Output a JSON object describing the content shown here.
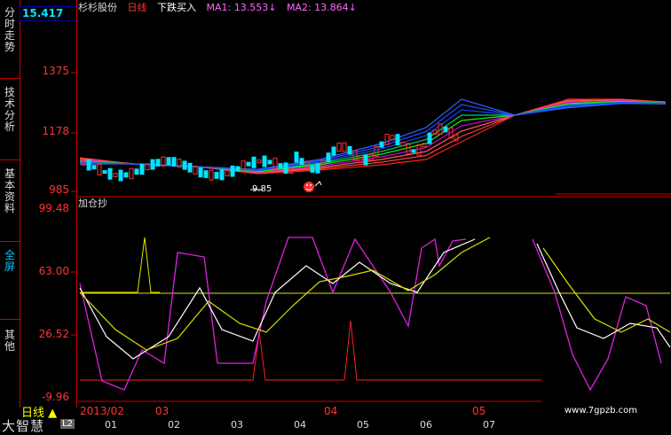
{
  "window": {
    "price_box": "15.417",
    "stock_name": "杉杉股份",
    "period": "日线",
    "signal": "下跌买入",
    "ma1_label": "MA1: 13.553↓",
    "ma2_label": "MA2: 13.864↓"
  },
  "sidebar": {
    "tabs": [
      {
        "label": "分时走势",
        "active": false
      },
      {
        "label": "技术分析",
        "active": false
      },
      {
        "label": "基本资料",
        "active": false
      },
      {
        "label": "全屏",
        "active": true
      },
      {
        "label": "其他",
        "active": false
      }
    ]
  },
  "price_axis": {
    "labels": [
      "1375",
      "1178",
      "985"
    ]
  },
  "kline_annotation": "9.85",
  "indicator": {
    "title": "加仓抄",
    "axis_labels": [
      "99.48",
      "63.00",
      "26.52",
      "-9.96"
    ]
  },
  "bottom_bar": {
    "period_label": "日线",
    "brand": "大智慧",
    "brand_badge": "L2",
    "months": [
      "2013/02",
      "03",
      "04",
      "05"
    ],
    "subticks": [
      "01",
      "02",
      "03",
      "04",
      "05",
      "06",
      "07"
    ],
    "site": "www.7gpzb.com"
  },
  "colors": {
    "axis_red": "#ff3333",
    "price_box": "#00e5ff",
    "ma_green": "#00ff00",
    "ma_blue": "#1a3cff",
    "ind_magenta": "#e020e0",
    "ind_white": "#ffffff",
    "ind_yellow": "#e0e000"
  }
}
